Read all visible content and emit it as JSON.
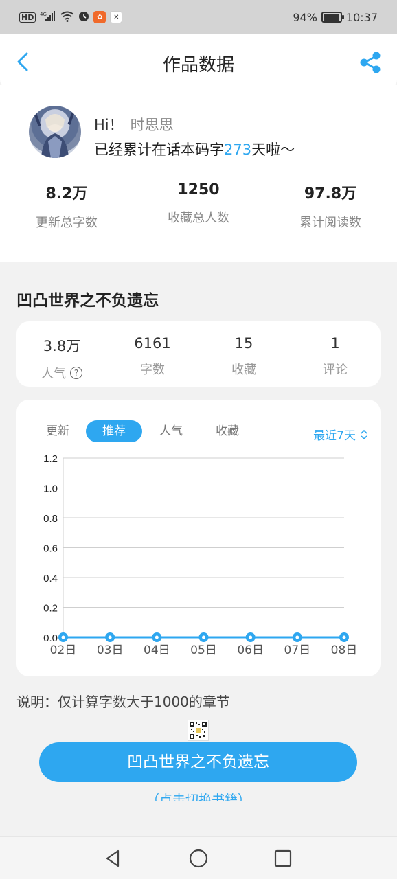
{
  "status_bar": {
    "network_label": "HD",
    "signal_label": "4G",
    "battery_text": "94%",
    "battery_level": 0.94,
    "time": "10:37",
    "icons": [
      "hd-icon",
      "signal-icon",
      "wifi-icon",
      "alarm-icon",
      "app-icon",
      "app-icon"
    ]
  },
  "header": {
    "title": "作品数据",
    "back_icon": "chevron-left-icon",
    "share_icon": "share-icon"
  },
  "profile": {
    "greeting": "Hi！",
    "username": "时思思",
    "days_prefix": "已经累计在话本码字",
    "days_count": "273",
    "days_suffix": "天啦～",
    "stats": [
      {
        "value": "8.2万",
        "label": "更新总字数"
      },
      {
        "value": "1250",
        "label": "收藏总人数"
      },
      {
        "value": "97.8万",
        "label": "累计阅读数"
      }
    ]
  },
  "book": {
    "title": "凹凸世界之不负遗忘",
    "stats": [
      {
        "value": "3.8万",
        "label": "人气"
      },
      {
        "value": "6161",
        "label": "字数"
      },
      {
        "value": "15",
        "label": "收藏"
      },
      {
        "value": "1",
        "label": "评论"
      }
    ]
  },
  "chart_panel": {
    "tabs": [
      "更新",
      "推荐",
      "人气",
      "收藏"
    ],
    "active_tab": "推荐",
    "range_label": "最近7天"
  },
  "chart_data": {
    "type": "line",
    "title": "",
    "xlabel": "",
    "ylabel": "",
    "x": [
      "02日",
      "03日",
      "04日",
      "05日",
      "06日",
      "07日",
      "08日"
    ],
    "series": [
      {
        "values": [
          0,
          0,
          0,
          0,
          0,
          0,
          0
        ]
      }
    ],
    "ylim": [
      0,
      1.2
    ],
    "y_ticks": [
      "0.0",
      "0.2",
      "0.4",
      "0.6",
      "0.8",
      "1.0",
      "1.2"
    ],
    "grid": true,
    "color": "#2ea7f0"
  },
  "footer": {
    "note": "说明：仅计算字数大于1000的章节",
    "main_button": "凹凸世界之不负遗忘",
    "switch_link": "（点击切换书籍）"
  },
  "colors": {
    "accent": "#2ea7f0",
    "background": "#f2f2f2",
    "card": "#ffffff"
  }
}
